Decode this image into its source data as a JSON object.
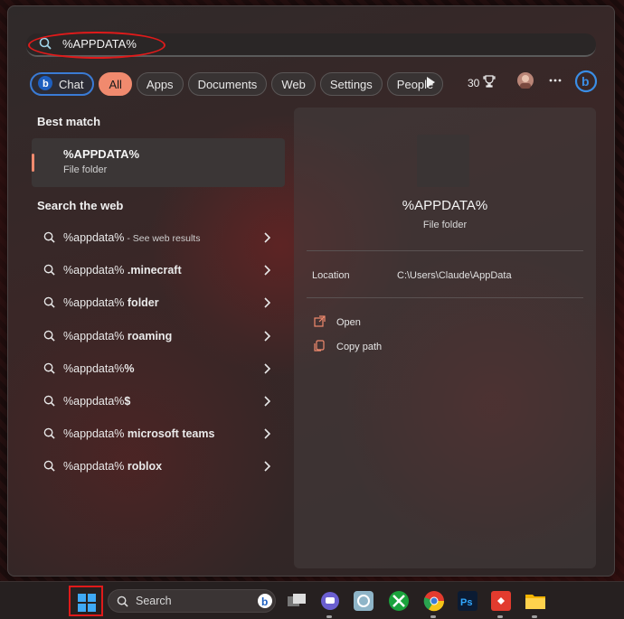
{
  "search": {
    "query": "%APPDATA%"
  },
  "filters": {
    "chat": "Chat",
    "all": "All",
    "apps": "Apps",
    "documents": "Documents",
    "web": "Web",
    "settings": "Settings",
    "people": "People",
    "points": "30"
  },
  "best_match": {
    "title": "Best match",
    "name": "%APPDATA%",
    "type": "File folder"
  },
  "search_web": {
    "title": "Search the web",
    "items": [
      {
        "query": "%appdata%",
        "bold": "",
        "suffix": " - See web results"
      },
      {
        "query": "%appdata%",
        "bold": " .minecraft",
        "suffix": ""
      },
      {
        "query": "%appdata%",
        "bold": " folder",
        "suffix": ""
      },
      {
        "query": "%appdata%",
        "bold": " roaming",
        "suffix": ""
      },
      {
        "query": "%appdata%",
        "bold": "%",
        "suffix": ""
      },
      {
        "query": "%appdata%",
        "bold": "$",
        "suffix": ""
      },
      {
        "query": "%appdata%",
        "bold": " microsoft teams",
        "suffix": ""
      },
      {
        "query": "%appdata%",
        "bold": " roblox",
        "suffix": ""
      }
    ]
  },
  "preview": {
    "name": "%APPDATA%",
    "type": "File folder",
    "location_label": "Location",
    "location_value": "C:\\Users\\Claude\\AppData",
    "open_label": "Open",
    "copy_path_label": "Copy path"
  },
  "taskbar": {
    "search_label": "Search"
  },
  "colors": {
    "accent": "#f08a6e",
    "highlight": "#e01a1a",
    "chat_border": "#3a7bd5"
  }
}
